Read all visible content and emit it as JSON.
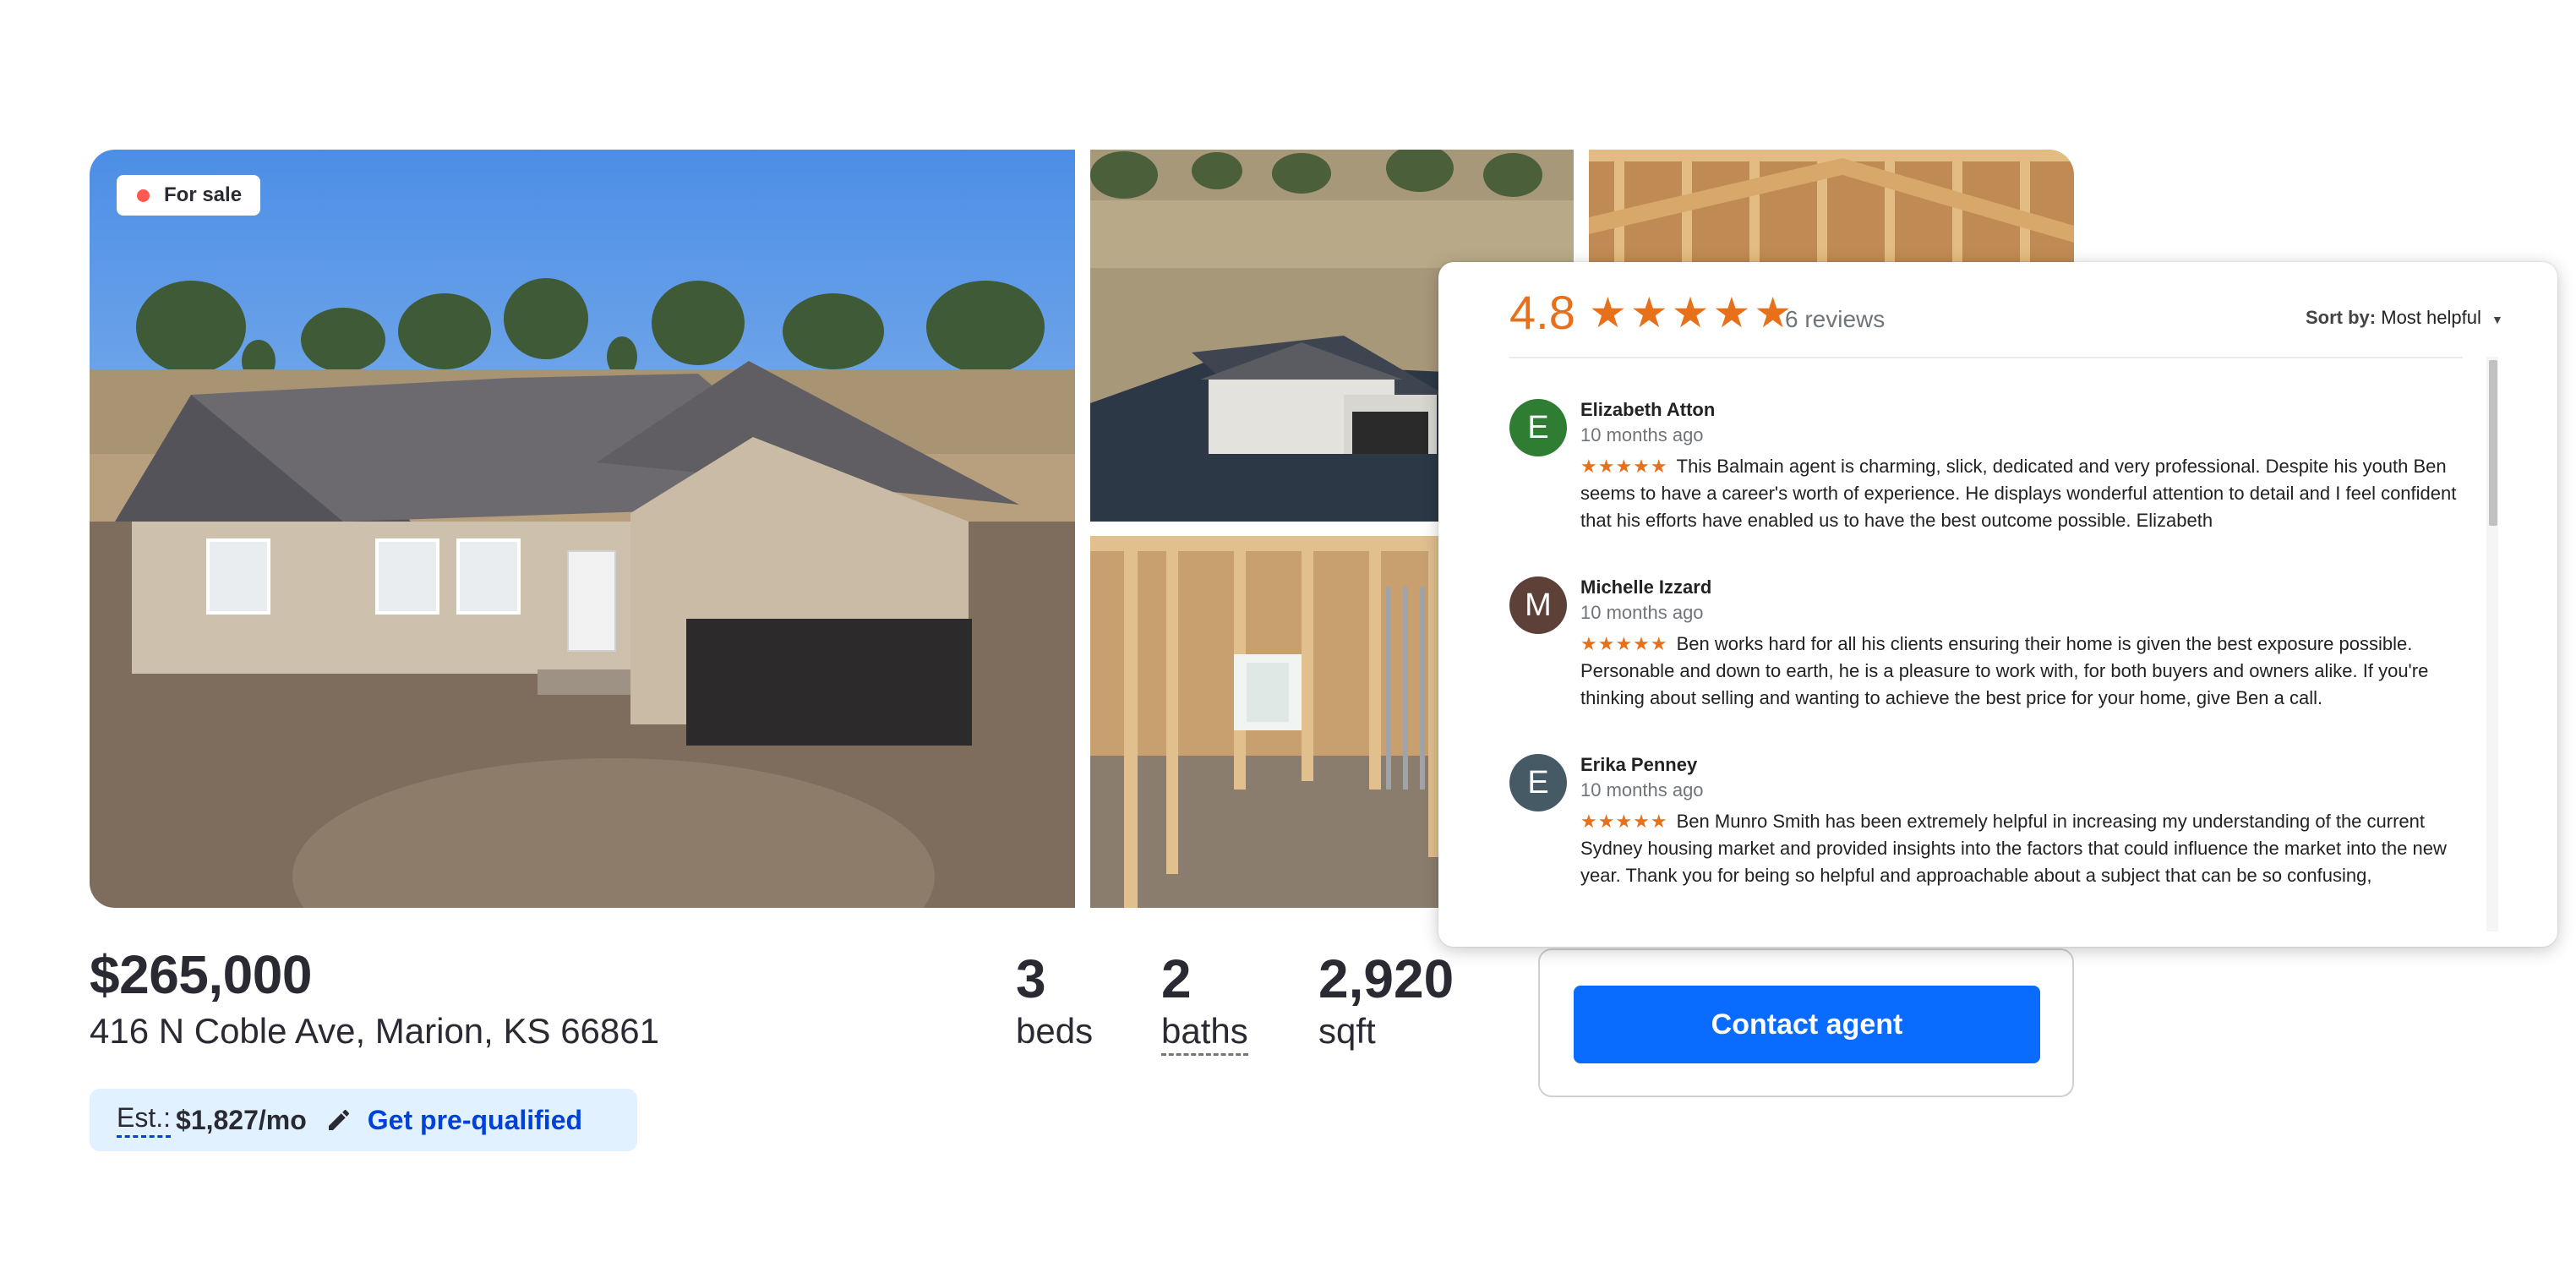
{
  "listing": {
    "status_badge": "For sale",
    "price": "$265,000",
    "address": "416 N Coble Ave, Marion, KS 66861",
    "estimate": {
      "label": "Est.:",
      "value": "$1,827/mo",
      "prequal_link": "Get pre-qualified"
    },
    "facts": {
      "beds": {
        "value": "3",
        "label": "beds"
      },
      "baths": {
        "value": "2",
        "label": "baths"
      },
      "sqft": {
        "value": "2,920",
        "label": "sqft"
      }
    },
    "contact_button": "Contact agent"
  },
  "colors": {
    "accent_blue": "#0a6cff",
    "link_blue": "#0041d9",
    "estimate_bg": "#e2f1ff",
    "status_dot": "#ff5a4f",
    "review_star": "#e7711b"
  },
  "reviews": {
    "rating": "4.8",
    "stars": "★★★★★",
    "count": "6 reviews",
    "sort_label": "Sort by:",
    "sort_value": "Most helpful",
    "items": [
      {
        "initial": "E",
        "avatar_color": "#2e7d32",
        "name": "Elizabeth Atton",
        "date": "10 months ago",
        "stars": "★★★★★",
        "text": "This Balmain agent is charming, slick, dedicated and very professional.  Despite his youth Ben seems to have a career's worth of experience.  He displays wonderful attention to detail and I feel confident that his efforts have enabled us to have the best outcome possible.  Elizabeth"
      },
      {
        "initial": "M",
        "avatar_color": "#5d4037",
        "name": "Michelle Izzard",
        "date": "10 months ago",
        "stars": "★★★★★",
        "text": "Ben works hard for all his clients ensuring their home is given the best exposure possible. Personable and down to earth, he is a pleasure to work with, for both buyers and owners alike. If you're thinking about selling and wanting to achieve the best price for your home, give Ben a call."
      },
      {
        "initial": "E",
        "avatar_color": "#455a64",
        "name": "Erika Penney",
        "date": "10 months ago",
        "stars": "★★★★★",
        "text": "Ben Munro Smith has been extremely helpful in increasing my understanding of the current Sydney housing market and provided insights into the factors that could influence the market into the new year. Thank you for being so helpful and approachable about a subject that can be so confusing,"
      }
    ]
  }
}
